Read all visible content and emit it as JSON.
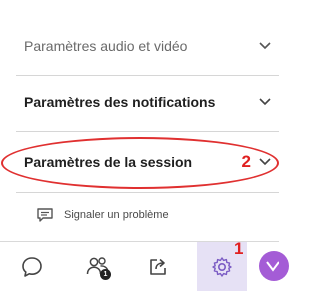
{
  "settings": {
    "items": [
      {
        "label": "Paramètres audio et vidéo"
      },
      {
        "label": "Paramètres des notifications"
      },
      {
        "label": "Paramètres de la session"
      }
    ],
    "report_label": "Signaler un problème"
  },
  "annotations": {
    "number_1": "1",
    "number_2": "2"
  },
  "tabbar": {
    "tabs": [
      {
        "icon": "chat-icon"
      },
      {
        "icon": "attendees-icon",
        "badge": "1"
      },
      {
        "icon": "share-icon"
      },
      {
        "icon": "gear-icon",
        "active": true
      },
      {
        "icon": "more-menu-icon"
      }
    ]
  },
  "colors": {
    "annotation": "#e02020",
    "active_tab_bg": "#e6e1f5",
    "active_icon": "#7b5cc4",
    "menu_button": "#a45cd6"
  }
}
